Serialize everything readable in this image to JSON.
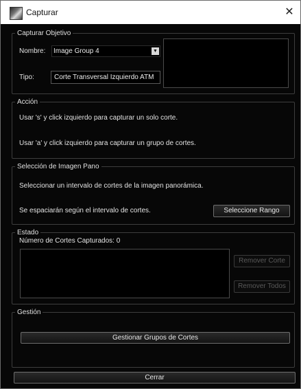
{
  "window": {
    "title": "Capturar",
    "close_glyph": "✕"
  },
  "capture_target": {
    "legend": "Capturar Objetivo",
    "name_label": "Nombre:",
    "name_value": "Image Group 4",
    "type_label": "Tipo:",
    "type_value": "Corte Transversal Izquierdo ATM"
  },
  "action": {
    "legend": "Acción",
    "line1": "Usar 's' y click izquierdo para capturar un solo corte.",
    "line2": "Usar 'a' y click izquierdo para capturar un grupo de cortes."
  },
  "pano": {
    "legend": "Selección de Imagen Pano",
    "line1": "Seleccionar un intervalo de cortes de la imagen panorámica.",
    "line2": "Se espaciarán según el intervalo de cortes.",
    "select_range_label": "Seleccione Rango"
  },
  "status": {
    "legend": "Estado",
    "count_label": "Número de Cortes Capturados: 0",
    "remove_slice_label": "Remover Corte",
    "remove_all_label": "Remover Todos"
  },
  "management": {
    "legend": "Gestión",
    "manage_groups_label": "Gestionar Grupos de Cortes"
  },
  "footer": {
    "close_label": "Cerrar"
  },
  "icons": {
    "app": "capture-app-icon",
    "dropdown": "triangle-down-icon",
    "close": "close-icon"
  }
}
